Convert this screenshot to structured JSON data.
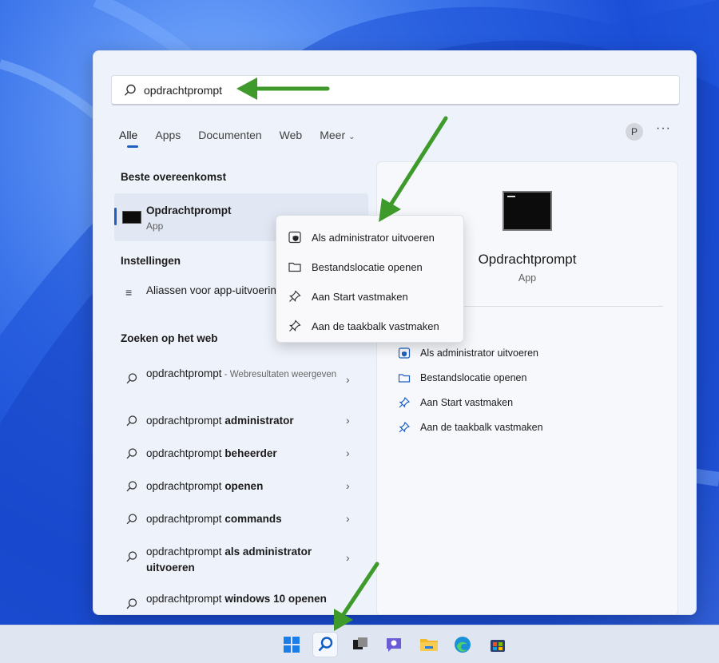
{
  "search": {
    "value": "opdrachtprompt"
  },
  "tabs": [
    {
      "label": "Alle",
      "active": true
    },
    {
      "label": "Apps"
    },
    {
      "label": "Documenten"
    },
    {
      "label": "Web"
    },
    {
      "label": "Meer"
    }
  ],
  "user_initial": "P",
  "more_label": "···",
  "sections": {
    "best_match": "Beste overeenkomst",
    "settings": "Instellingen",
    "web": "Zoeken op het web"
  },
  "best_match": {
    "name": "Opdrachtprompt",
    "type": "App"
  },
  "settings_item": {
    "label": "Aliassen voor app-uitvoering beheren"
  },
  "web_results": [
    {
      "prefix": "opdrachtprompt",
      "bold": "",
      "suffix": " - Webresultaten weergeven"
    },
    {
      "prefix": "opdrachtprompt ",
      "bold": "administrator",
      "suffix": ""
    },
    {
      "prefix": "opdrachtprompt ",
      "bold": "beheerder",
      "suffix": ""
    },
    {
      "prefix": "opdrachtprompt ",
      "bold": "openen",
      "suffix": ""
    },
    {
      "prefix": "opdrachtprompt ",
      "bold": "commands",
      "suffix": ""
    },
    {
      "prefix": "opdrachtprompt ",
      "bold": "als administrator uitvoeren",
      "suffix": ""
    },
    {
      "prefix": "opdrachtprompt ",
      "bold": "windows 10 openen",
      "suffix": ""
    }
  ],
  "details": {
    "title": "Opdrachtprompt",
    "type": "App",
    "actions": [
      {
        "label": "Als administrator uitvoeren",
        "icon": "shield-icon"
      },
      {
        "label": "Bestandslocatie openen",
        "icon": "folder-icon"
      },
      {
        "label": "Aan Start vastmaken",
        "icon": "pin-icon"
      },
      {
        "label": "Aan de taakbalk vastmaken",
        "icon": "pin-icon"
      }
    ]
  },
  "context_menu": [
    {
      "label": "Als administrator uitvoeren",
      "icon": "shield-icon"
    },
    {
      "label": "Bestandslocatie openen",
      "icon": "folder-icon"
    },
    {
      "label": "Aan Start vastmaken",
      "icon": "pin-icon"
    },
    {
      "label": "Aan de taakbalk vastmaken",
      "icon": "pin-icon"
    }
  ],
  "taskbar": [
    {
      "icon": "windows-start-icon"
    },
    {
      "icon": "search-icon",
      "active": true
    },
    {
      "icon": "task-view-icon"
    },
    {
      "icon": "teams-chat-icon"
    },
    {
      "icon": "file-explorer-icon"
    },
    {
      "icon": "edge-browser-icon"
    },
    {
      "icon": "microsoft-store-icon"
    }
  ],
  "colors": {
    "accent": "#1f5fbf",
    "annotation_arrow": "#3d9a2b"
  }
}
